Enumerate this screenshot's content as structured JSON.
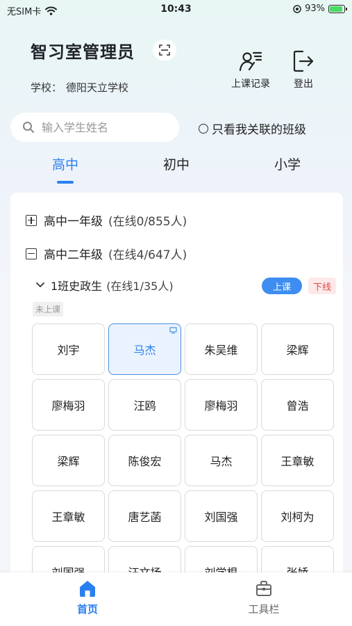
{
  "status_bar": {
    "carrier": "无SIM卡",
    "time": "10:43",
    "battery": "93%"
  },
  "header": {
    "title": "智习室管理员",
    "school_label": "学校：",
    "school_name": "德阳天立学校",
    "actions": [
      {
        "label": "上课记录",
        "icon": "class-record-icon"
      },
      {
        "label": "登出",
        "icon": "logout-icon"
      }
    ]
  },
  "search": {
    "placeholder": "输入学生姓名"
  },
  "filter": {
    "label": "只看我关联的班级"
  },
  "tabs": [
    {
      "label": "高中",
      "active": true
    },
    {
      "label": "初中"
    },
    {
      "label": "小学"
    }
  ],
  "grades": [
    {
      "name": "高中一年级",
      "count": "(在线0/855人)",
      "expanded": false
    },
    {
      "name": "高中二年级",
      "count": "(在线4/647人)",
      "expanded": true
    }
  ],
  "class": {
    "name": "1班史政生",
    "count": "(在线1/35人)",
    "start_label": "上课",
    "end_label": "下线",
    "status": "未上课"
  },
  "students": [
    {
      "name": "刘宇"
    },
    {
      "name": "马杰",
      "online": true
    },
    {
      "name": "朱吴维"
    },
    {
      "name": "梁辉"
    },
    {
      "name": "廖梅羽"
    },
    {
      "name": "汪鸥"
    },
    {
      "name": "廖梅羽"
    },
    {
      "name": "曾浩"
    },
    {
      "name": "梁辉"
    },
    {
      "name": "陈俊宏"
    },
    {
      "name": "马杰"
    },
    {
      "name": "王章敏"
    },
    {
      "name": "王章敏"
    },
    {
      "name": "唐艺菡"
    },
    {
      "name": "刘国强"
    },
    {
      "name": "刘柯为"
    },
    {
      "name": "刘国强"
    },
    {
      "name": "汪文扬"
    },
    {
      "name": "刘学根"
    },
    {
      "name": "张娇"
    }
  ],
  "colors": {
    "accent": "#2b7ff0",
    "end": "#e04a4a"
  },
  "bottom_nav": [
    {
      "label": "首页",
      "icon": "home-icon",
      "active": true
    },
    {
      "label": "工具栏",
      "icon": "toolbox-icon"
    }
  ]
}
